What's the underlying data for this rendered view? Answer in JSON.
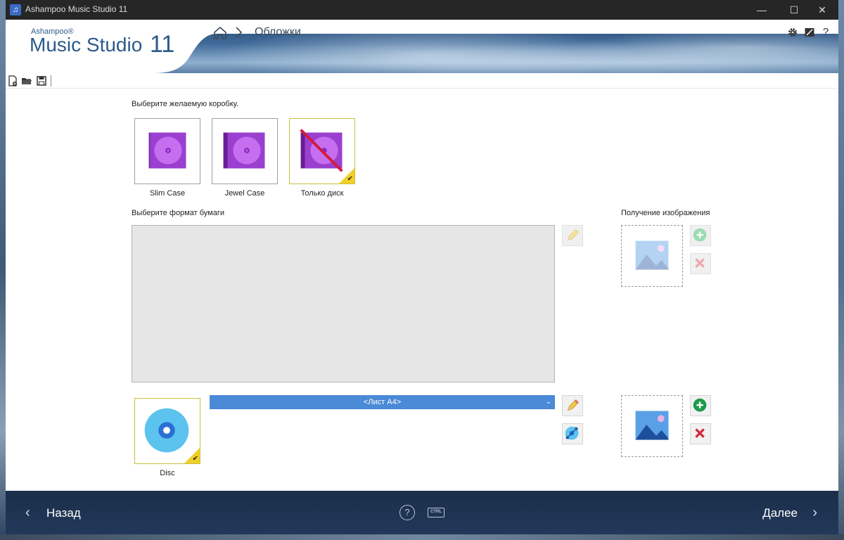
{
  "window": {
    "title": "Ashampoo Music Studio 11",
    "app_icon": "music-note-icon",
    "controls": [
      "—",
      "☐",
      "✕"
    ]
  },
  "header": {
    "brand_small": "Ashampoo®",
    "brand_big": "Music Studio",
    "brand_num": "11",
    "breadcrumb_current": "Обложки",
    "icons": [
      "gear-icon",
      "edit-icon",
      "help-icon"
    ],
    "help_glyph": "?"
  },
  "toolbar": {
    "icons": [
      "new-project-icon",
      "open-folder-icon",
      "save-icon"
    ]
  },
  "case_section": {
    "prompt": "Выберите желаемую коробку.",
    "cases": [
      {
        "label": "Slim Case",
        "selected": false
      },
      {
        "label": "Jewel Case",
        "selected": false
      },
      {
        "label": "Только диск",
        "selected": true
      }
    ]
  },
  "paper_section": {
    "prompt": "Выберите формат бумаги",
    "format_value": "<Лист A4>"
  },
  "image_section": {
    "prompt": "Получение изображения"
  },
  "disc": {
    "label": "Disc",
    "selected": true
  },
  "footer": {
    "back_label": "Назад",
    "next_label": "Далее",
    "help_glyph": "?",
    "ctrl_label": "CTRL"
  },
  "colors": {
    "accent_blue": "#4a8ad6",
    "case_purple": "#8b2bbf",
    "check_yellow": "#f2cf2a",
    "footer_bg": "#1b2f4a"
  }
}
